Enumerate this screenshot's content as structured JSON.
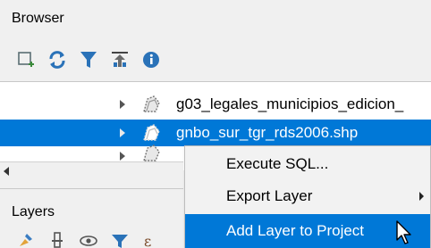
{
  "browser": {
    "title": "Browser",
    "toolbar": [
      "add-layer-icon",
      "refresh-icon",
      "filter-icon",
      "collapse-all-icon",
      "info-icon"
    ]
  },
  "tree": {
    "items": [
      {
        "label": "g03_legales_municipios_edicion_",
        "selected": false
      },
      {
        "label": "gnbo_sur_tgr_rds2006.shp",
        "selected": true
      },
      {
        "label": "",
        "selected": false
      }
    ]
  },
  "layers": {
    "title": "Layers",
    "toolbar": [
      "style-icon",
      "add-group-icon",
      "visibility-icon",
      "filter-icon",
      "expression-icon"
    ]
  },
  "context_menu": {
    "items": [
      {
        "label": "Execute SQL...",
        "has_submenu": false,
        "highlighted": false
      },
      {
        "label": "Export Layer",
        "has_submenu": true,
        "highlighted": false
      },
      {
        "label": "Add Layer to Project",
        "has_submenu": false,
        "highlighted": true
      }
    ]
  },
  "colors": {
    "selection": "#0078d7",
    "panel_bg": "#f0f0f0",
    "menu_bg": "#f2f2f2",
    "toolbar_accent": "#1f6fb5"
  }
}
